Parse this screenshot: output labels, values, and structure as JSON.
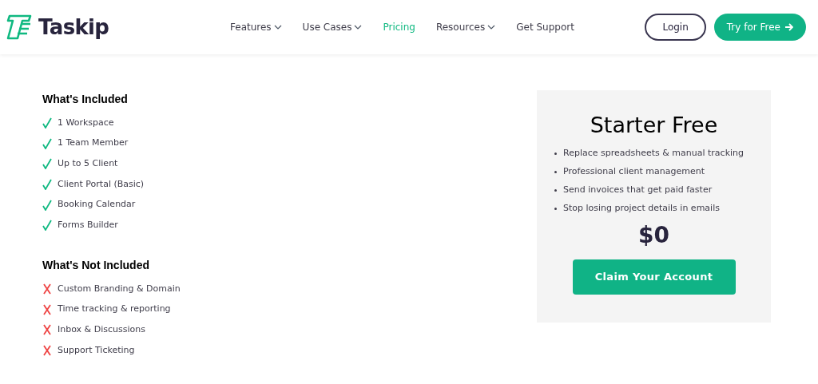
{
  "header": {
    "logo_text": "Taskip",
    "nav": [
      {
        "label": "Features",
        "dropdown": true,
        "selected": false
      },
      {
        "label": "Use Cases",
        "dropdown": true,
        "selected": false
      },
      {
        "label": "Pricing",
        "dropdown": false,
        "selected": true
      },
      {
        "label": "Resources",
        "dropdown": true,
        "selected": false
      },
      {
        "label": "Get Support",
        "dropdown": false,
        "selected": false
      }
    ],
    "login": "Login",
    "cta": "Try for Free"
  },
  "sections": [
    {
      "title": "What's Included",
      "kind": "included",
      "items": [
        "1 Workspace",
        "1 Team Member",
        "Up to 5 Client",
        "Client Portal (Basic)",
        "Booking Calendar",
        "Forms Builder"
      ]
    },
    {
      "title": "What's Not Included",
      "kind": "excluded",
      "items": [
        "Custom Branding & Domain",
        "Time tracking & reporting",
        "Inbox & Discussions",
        "Support Ticketing"
      ]
    }
  ],
  "plan": {
    "name": "Starter Free",
    "features": [
      "Replace spreadsheets & manual tracking",
      "Professional client management",
      "Send invoices that get paid faster",
      "Stop losing project details in emails"
    ],
    "price": "$0",
    "button": "Claim Your Account"
  }
}
